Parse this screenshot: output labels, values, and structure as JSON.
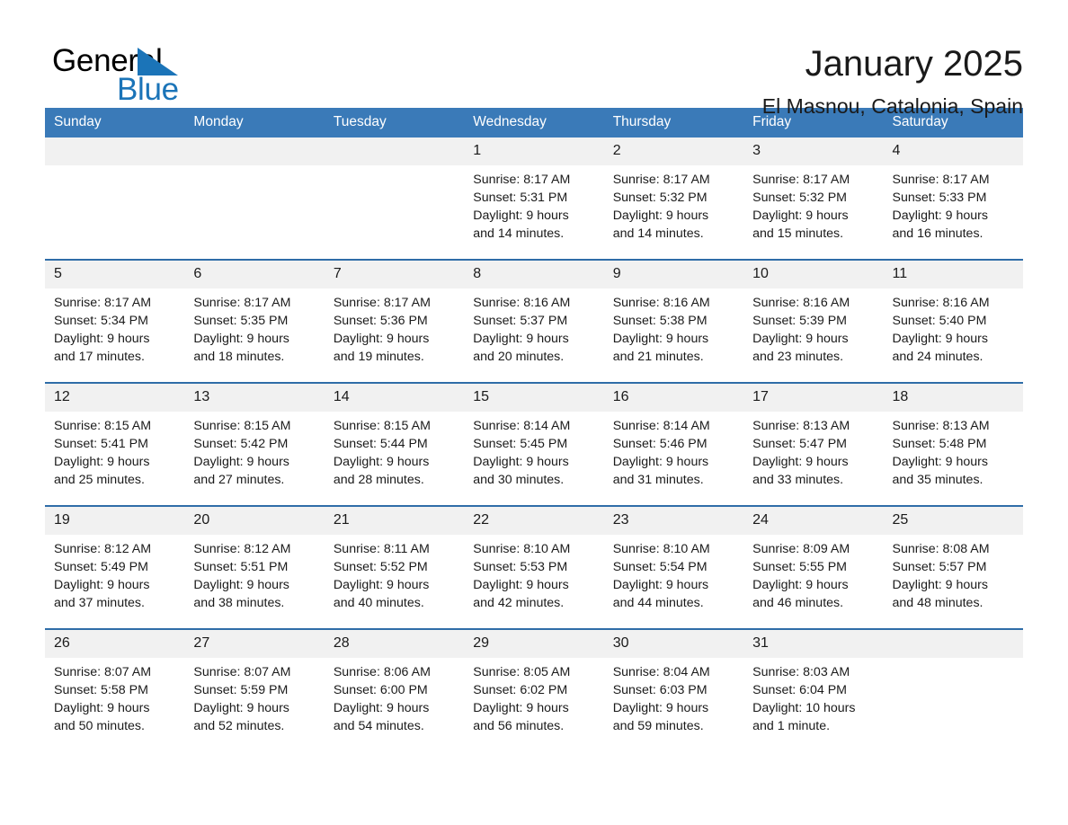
{
  "logo": {
    "word_one": "General",
    "word_two": "Blue",
    "triangle_color": "#1b74b8"
  },
  "header": {
    "title": "January 2025",
    "location": "El Masnou, Catalonia, Spain"
  },
  "theme": {
    "header_blue": "#3a7ab8",
    "row_divider_blue": "#2f6da8",
    "daynum_band": "#f1f1f1",
    "text": "#1a1a1a"
  },
  "weekday_headers": [
    "Sunday",
    "Monday",
    "Tuesday",
    "Wednesday",
    "Thursday",
    "Friday",
    "Saturday"
  ],
  "weeks": [
    [
      {
        "day": "",
        "empty": true
      },
      {
        "day": "",
        "empty": true
      },
      {
        "day": "",
        "empty": true
      },
      {
        "day": "1",
        "sunrise": "Sunrise: 8:17 AM",
        "sunset": "Sunset: 5:31 PM",
        "daylight_1": "Daylight: 9 hours",
        "daylight_2": "and 14 minutes."
      },
      {
        "day": "2",
        "sunrise": "Sunrise: 8:17 AM",
        "sunset": "Sunset: 5:32 PM",
        "daylight_1": "Daylight: 9 hours",
        "daylight_2": "and 14 minutes."
      },
      {
        "day": "3",
        "sunrise": "Sunrise: 8:17 AM",
        "sunset": "Sunset: 5:32 PM",
        "daylight_1": "Daylight: 9 hours",
        "daylight_2": "and 15 minutes."
      },
      {
        "day": "4",
        "sunrise": "Sunrise: 8:17 AM",
        "sunset": "Sunset: 5:33 PM",
        "daylight_1": "Daylight: 9 hours",
        "daylight_2": "and 16 minutes."
      }
    ],
    [
      {
        "day": "5",
        "sunrise": "Sunrise: 8:17 AM",
        "sunset": "Sunset: 5:34 PM",
        "daylight_1": "Daylight: 9 hours",
        "daylight_2": "and 17 minutes."
      },
      {
        "day": "6",
        "sunrise": "Sunrise: 8:17 AM",
        "sunset": "Sunset: 5:35 PM",
        "daylight_1": "Daylight: 9 hours",
        "daylight_2": "and 18 minutes."
      },
      {
        "day": "7",
        "sunrise": "Sunrise: 8:17 AM",
        "sunset": "Sunset: 5:36 PM",
        "daylight_1": "Daylight: 9 hours",
        "daylight_2": "and 19 minutes."
      },
      {
        "day": "8",
        "sunrise": "Sunrise: 8:16 AM",
        "sunset": "Sunset: 5:37 PM",
        "daylight_1": "Daylight: 9 hours",
        "daylight_2": "and 20 minutes."
      },
      {
        "day": "9",
        "sunrise": "Sunrise: 8:16 AM",
        "sunset": "Sunset: 5:38 PM",
        "daylight_1": "Daylight: 9 hours",
        "daylight_2": "and 21 minutes."
      },
      {
        "day": "10",
        "sunrise": "Sunrise: 8:16 AM",
        "sunset": "Sunset: 5:39 PM",
        "daylight_1": "Daylight: 9 hours",
        "daylight_2": "and 23 minutes."
      },
      {
        "day": "11",
        "sunrise": "Sunrise: 8:16 AM",
        "sunset": "Sunset: 5:40 PM",
        "daylight_1": "Daylight: 9 hours",
        "daylight_2": "and 24 minutes."
      }
    ],
    [
      {
        "day": "12",
        "sunrise": "Sunrise: 8:15 AM",
        "sunset": "Sunset: 5:41 PM",
        "daylight_1": "Daylight: 9 hours",
        "daylight_2": "and 25 minutes."
      },
      {
        "day": "13",
        "sunrise": "Sunrise: 8:15 AM",
        "sunset": "Sunset: 5:42 PM",
        "daylight_1": "Daylight: 9 hours",
        "daylight_2": "and 27 minutes."
      },
      {
        "day": "14",
        "sunrise": "Sunrise: 8:15 AM",
        "sunset": "Sunset: 5:44 PM",
        "daylight_1": "Daylight: 9 hours",
        "daylight_2": "and 28 minutes."
      },
      {
        "day": "15",
        "sunrise": "Sunrise: 8:14 AM",
        "sunset": "Sunset: 5:45 PM",
        "daylight_1": "Daylight: 9 hours",
        "daylight_2": "and 30 minutes."
      },
      {
        "day": "16",
        "sunrise": "Sunrise: 8:14 AM",
        "sunset": "Sunset: 5:46 PM",
        "daylight_1": "Daylight: 9 hours",
        "daylight_2": "and 31 minutes."
      },
      {
        "day": "17",
        "sunrise": "Sunrise: 8:13 AM",
        "sunset": "Sunset: 5:47 PM",
        "daylight_1": "Daylight: 9 hours",
        "daylight_2": "and 33 minutes."
      },
      {
        "day": "18",
        "sunrise": "Sunrise: 8:13 AM",
        "sunset": "Sunset: 5:48 PM",
        "daylight_1": "Daylight: 9 hours",
        "daylight_2": "and 35 minutes."
      }
    ],
    [
      {
        "day": "19",
        "sunrise": "Sunrise: 8:12 AM",
        "sunset": "Sunset: 5:49 PM",
        "daylight_1": "Daylight: 9 hours",
        "daylight_2": "and 37 minutes."
      },
      {
        "day": "20",
        "sunrise": "Sunrise: 8:12 AM",
        "sunset": "Sunset: 5:51 PM",
        "daylight_1": "Daylight: 9 hours",
        "daylight_2": "and 38 minutes."
      },
      {
        "day": "21",
        "sunrise": "Sunrise: 8:11 AM",
        "sunset": "Sunset: 5:52 PM",
        "daylight_1": "Daylight: 9 hours",
        "daylight_2": "and 40 minutes."
      },
      {
        "day": "22",
        "sunrise": "Sunrise: 8:10 AM",
        "sunset": "Sunset: 5:53 PM",
        "daylight_1": "Daylight: 9 hours",
        "daylight_2": "and 42 minutes."
      },
      {
        "day": "23",
        "sunrise": "Sunrise: 8:10 AM",
        "sunset": "Sunset: 5:54 PM",
        "daylight_1": "Daylight: 9 hours",
        "daylight_2": "and 44 minutes."
      },
      {
        "day": "24",
        "sunrise": "Sunrise: 8:09 AM",
        "sunset": "Sunset: 5:55 PM",
        "daylight_1": "Daylight: 9 hours",
        "daylight_2": "and 46 minutes."
      },
      {
        "day": "25",
        "sunrise": "Sunrise: 8:08 AM",
        "sunset": "Sunset: 5:57 PM",
        "daylight_1": "Daylight: 9 hours",
        "daylight_2": "and 48 minutes."
      }
    ],
    [
      {
        "day": "26",
        "sunrise": "Sunrise: 8:07 AM",
        "sunset": "Sunset: 5:58 PM",
        "daylight_1": "Daylight: 9 hours",
        "daylight_2": "and 50 minutes."
      },
      {
        "day": "27",
        "sunrise": "Sunrise: 8:07 AM",
        "sunset": "Sunset: 5:59 PM",
        "daylight_1": "Daylight: 9 hours",
        "daylight_2": "and 52 minutes."
      },
      {
        "day": "28",
        "sunrise": "Sunrise: 8:06 AM",
        "sunset": "Sunset: 6:00 PM",
        "daylight_1": "Daylight: 9 hours",
        "daylight_2": "and 54 minutes."
      },
      {
        "day": "29",
        "sunrise": "Sunrise: 8:05 AM",
        "sunset": "Sunset: 6:02 PM",
        "daylight_1": "Daylight: 9 hours",
        "daylight_2": "and 56 minutes."
      },
      {
        "day": "30",
        "sunrise": "Sunrise: 8:04 AM",
        "sunset": "Sunset: 6:03 PM",
        "daylight_1": "Daylight: 9 hours",
        "daylight_2": "and 59 minutes."
      },
      {
        "day": "31",
        "sunrise": "Sunrise: 8:03 AM",
        "sunset": "Sunset: 6:04 PM",
        "daylight_1": "Daylight: 10 hours",
        "daylight_2": "and 1 minute."
      },
      {
        "day": "",
        "empty": true
      }
    ]
  ]
}
